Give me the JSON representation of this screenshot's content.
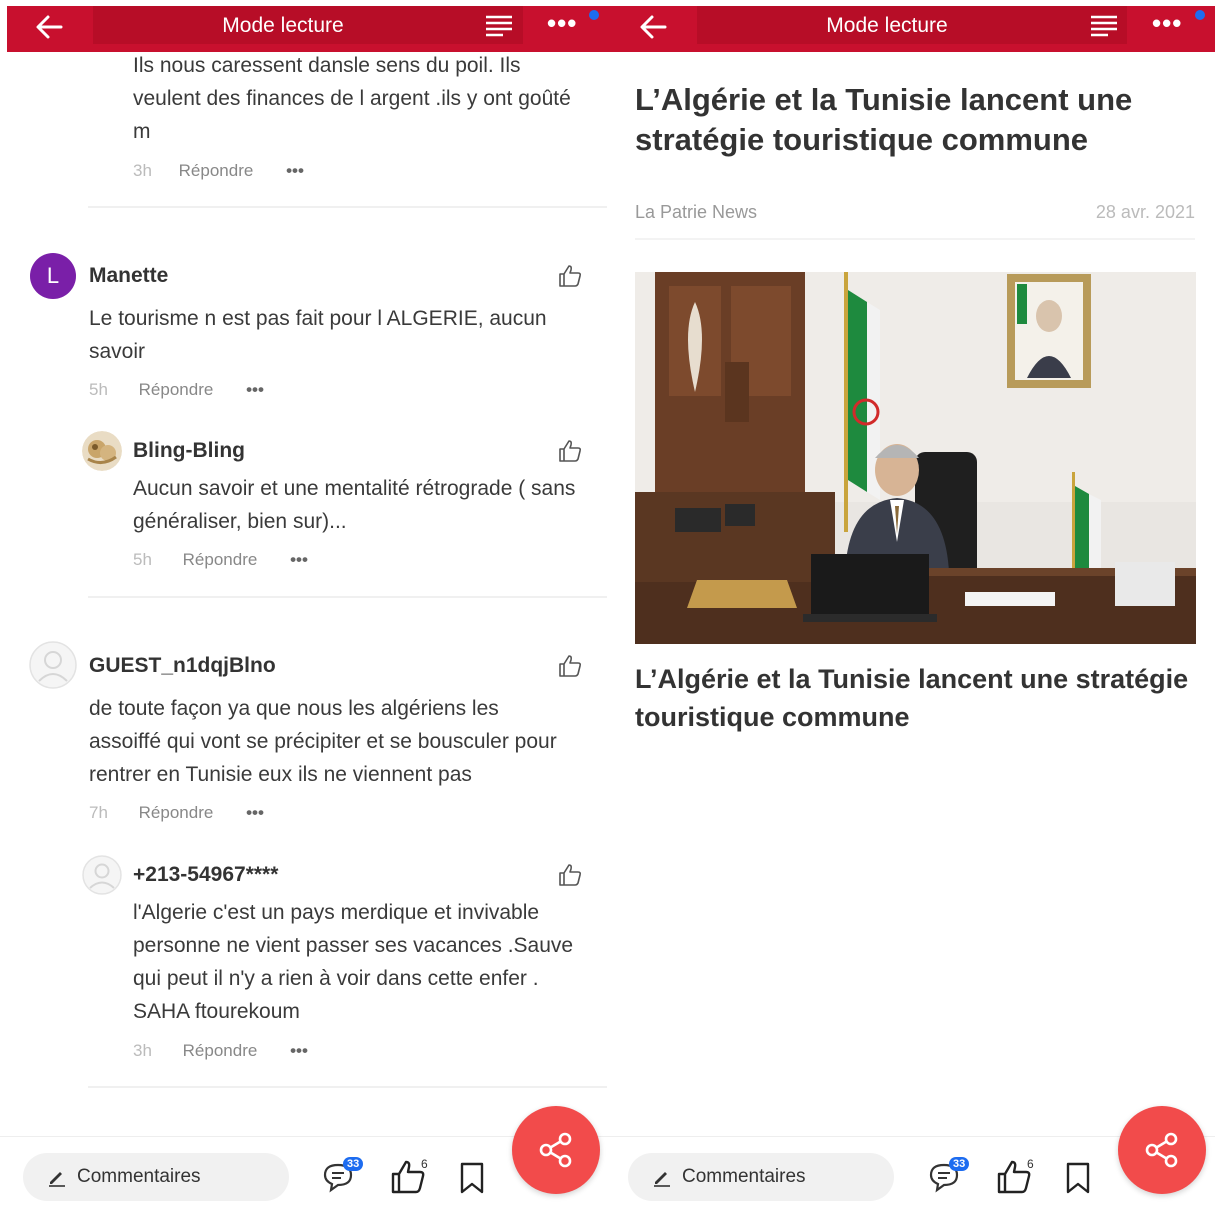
{
  "topbar": {
    "title": "Mode lecture",
    "more_label": "•••"
  },
  "left": {
    "comments": [
      {
        "text": "Ils nous caressent dansle sens du poil. Ils veulent des finances de l argent .ils y ont goûté m",
        "time": "3h"
      },
      {
        "avatar_letter": "L",
        "author": "Manette",
        "text": "Le tourisme n est pas fait pour l ALGERIE, aucun savoir",
        "time": "5h"
      },
      {
        "author": "Bling-Bling",
        "text": "Aucun savoir et une mentalité rétrograde ( sans généraliser, bien sur)...",
        "time": "5h"
      },
      {
        "author": "GUEST_n1dqjBlno",
        "text": "de toute façon ya que nous les algériens les assoiffé qui vont se précipiter et se bousculer pour rentrer en Tunisie eux ils ne viennent pas",
        "time": "7h"
      },
      {
        "author": "+213-54967****",
        "text": "l'Algerie c'est un pays merdique et invivable personne ne vient passer ses vacances .Sauve qui peut il n'y a rien à voir dans cette enfer . SAHA ftourekoum",
        "time": "3h"
      }
    ],
    "reply_label": "Répondre",
    "more_label": "•••"
  },
  "article": {
    "headline": "L’Algérie et la Tunisie lancent une stratégie touristique commune",
    "source": "La Patrie News",
    "date": "28 avr. 2021",
    "caption": "L’Algérie et la Tunisie lancent une stratégie touristique commune"
  },
  "bottombar": {
    "comments_label": "Commentaires",
    "comment_count": "33",
    "like_count": "6"
  },
  "colors": {
    "topbar": "#c8102e",
    "fab": "#f24b4b",
    "badge": "#1d6cf0",
    "avatar_manette": "#7a1fa8"
  }
}
